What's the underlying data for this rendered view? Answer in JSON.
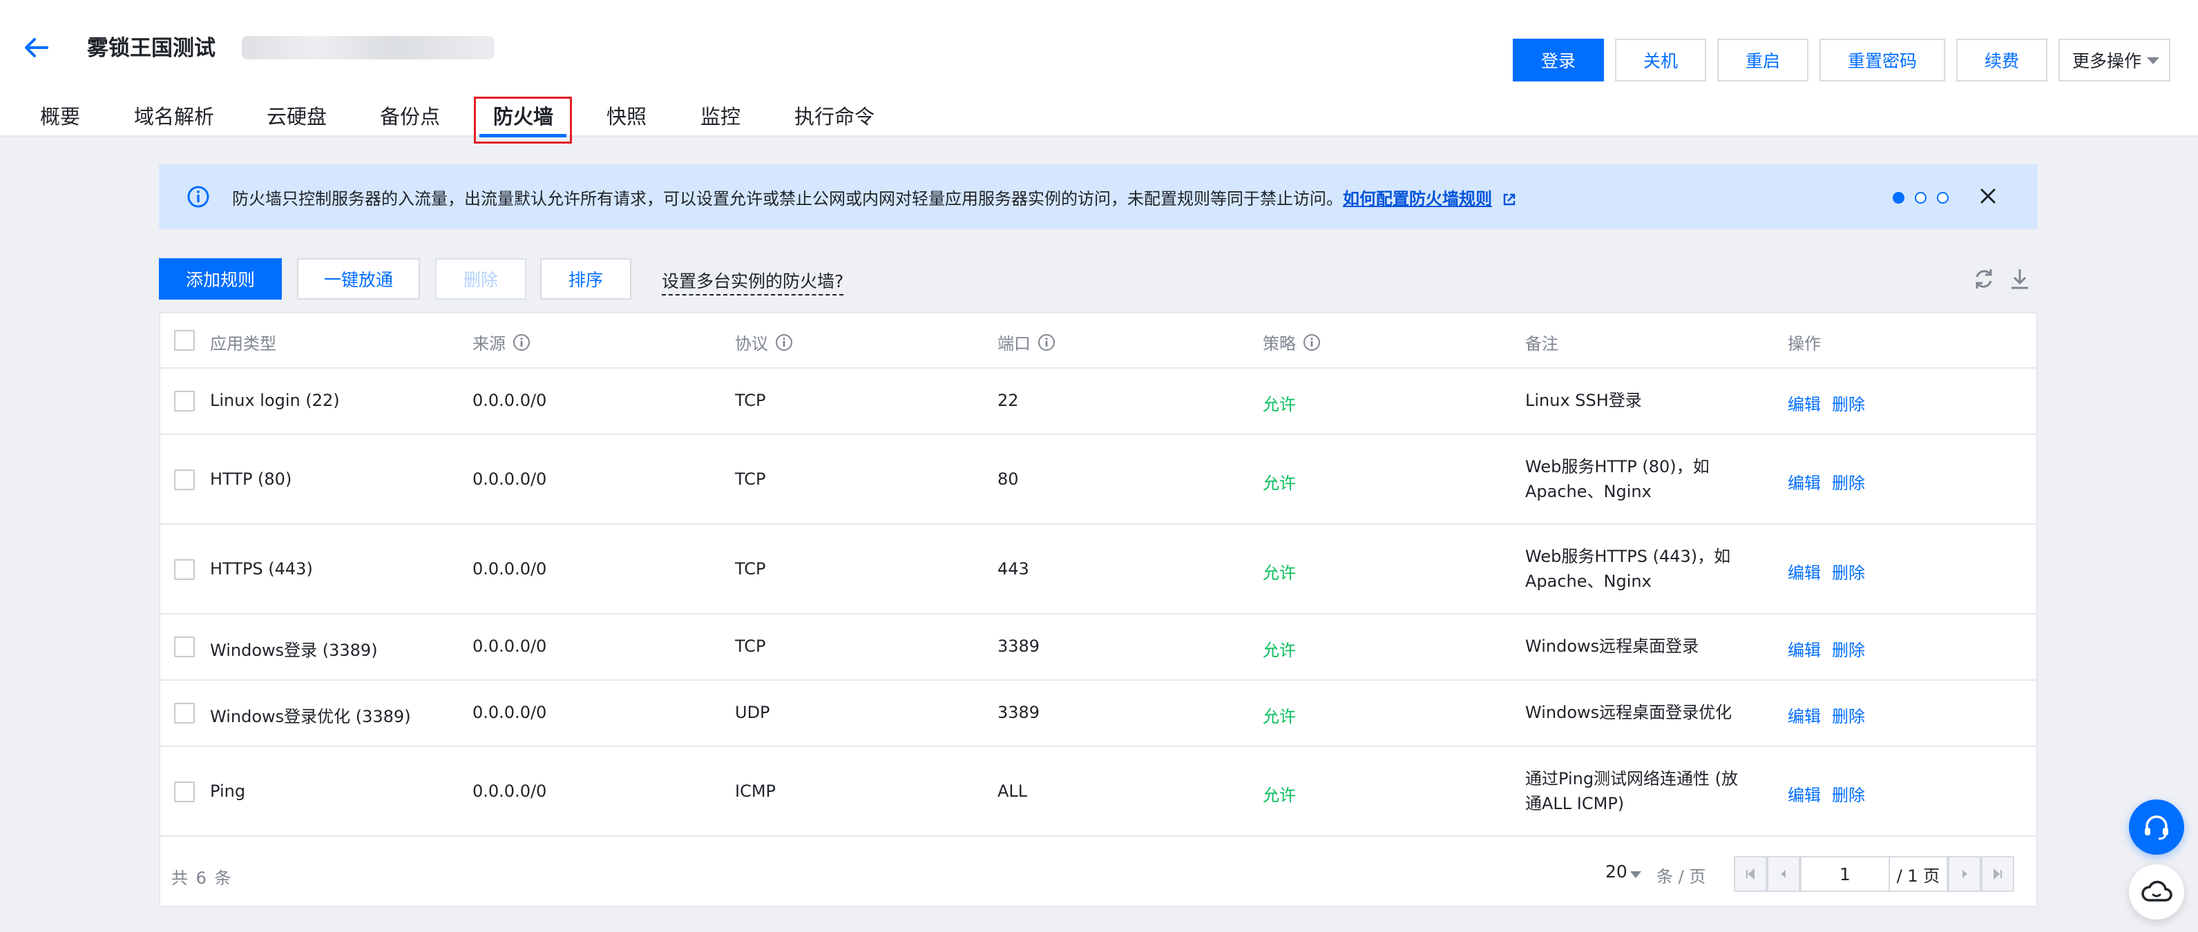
{
  "header": {
    "title": "雾锁王国测试",
    "buttons": {
      "login": "登录",
      "shutdown": "关机",
      "restart": "重启",
      "reset_password": "重置密码",
      "renew": "续费",
      "more": "更多操作"
    },
    "tabs": [
      "概要",
      "域名解析",
      "云硬盘",
      "备份点",
      "防火墙",
      "快照",
      "监控",
      "执行命令"
    ],
    "active_tab": "防火墙"
  },
  "notice": {
    "text": "防火墙只控制服务器的入流量，出流量默认允许所有请求，可以设置允许或禁止公网或内网对轻量应用服务器实例的访问，未配置规则等同于禁止访问。",
    "link": "如何配置防火墙规则",
    "pages": 3,
    "current_page": 1
  },
  "toolbar": {
    "add_rule": "添加规则",
    "allow_all": "一键放通",
    "delete": "删除",
    "sort": "排序",
    "multi_instance_link": "设置多台实例的防火墙?"
  },
  "table": {
    "headers": {
      "app_type": "应用类型",
      "source": "来源",
      "protocol": "协议",
      "port": "端口",
      "policy": "策略",
      "note": "备注",
      "actions": "操作"
    },
    "edit_label": "编辑",
    "delete_label": "删除",
    "rows": [
      {
        "app_type": "Linux login (22)",
        "source": "0.0.0.0/0",
        "protocol": "TCP",
        "port": "22",
        "policy": "允许",
        "note": "Linux SSH登录"
      },
      {
        "app_type": "HTTP (80)",
        "source": "0.0.0.0/0",
        "protocol": "TCP",
        "port": "80",
        "policy": "允许",
        "note": "Web服务HTTP (80)，如Apache、Nginx"
      },
      {
        "app_type": "HTTPS (443)",
        "source": "0.0.0.0/0",
        "protocol": "TCP",
        "port": "443",
        "policy": "允许",
        "note": "Web服务HTTPS (443)，如Apache、Nginx"
      },
      {
        "app_type": "Windows登录 (3389)",
        "source": "0.0.0.0/0",
        "protocol": "TCP",
        "port": "3389",
        "policy": "允许",
        "note": "Windows远程桌面登录"
      },
      {
        "app_type": "Windows登录优化 (3389)",
        "source": "0.0.0.0/0",
        "protocol": "UDP",
        "port": "3389",
        "policy": "允许",
        "note": "Windows远程桌面登录优化"
      },
      {
        "app_type": "Ping",
        "source": "0.0.0.0/0",
        "protocol": "ICMP",
        "port": "ALL",
        "policy": "允许",
        "note": "通过Ping测试网络连通性 (放通ALL ICMP)"
      }
    ]
  },
  "pagination": {
    "total": "共 6 条",
    "page_size": "20",
    "per_page_label": "条 / 页",
    "current_page": "1",
    "total_pages": "/ 1 页"
  },
  "colors": {
    "primary": "#006eff",
    "allow": "#0abf5b",
    "highlight_border": "#e21f26",
    "notice_bg": "#d5e7ff"
  }
}
